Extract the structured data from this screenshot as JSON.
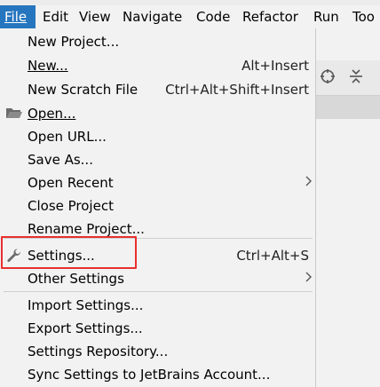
{
  "menubar": {
    "items": [
      {
        "label": "File",
        "mnemonic_index": 0
      },
      {
        "label": "Edit",
        "mnemonic_index": 0
      },
      {
        "label": "View",
        "mnemonic_index": 0
      },
      {
        "label": "Navigate",
        "mnemonic_index": 0
      },
      {
        "label": "Code",
        "mnemonic_index": 0
      },
      {
        "label": "Refactor",
        "mnemonic_index": 0
      },
      {
        "label": "Run",
        "mnemonic_index": 1
      },
      {
        "label": "Too",
        "mnemonic_index": 2
      }
    ]
  },
  "menu": {
    "items": [
      {
        "label": "New Project...",
        "shortcut": ""
      },
      {
        "label": "New...",
        "shortcut": "Alt+Insert"
      },
      {
        "label": "New Scratch File",
        "shortcut": "Ctrl+Alt+Shift+Insert"
      },
      {
        "label": "Open...",
        "shortcut": "",
        "icon": "folder-icon"
      },
      {
        "label": "Open URL...",
        "shortcut": ""
      },
      {
        "label": "Save As...",
        "shortcut": ""
      },
      {
        "label": "Open Recent",
        "shortcut": "",
        "submenu": true
      },
      {
        "label": "Close Project",
        "shortcut": ""
      },
      {
        "label": "Rename Project...",
        "shortcut": ""
      },
      {
        "label": "Settings...",
        "shortcut": "Ctrl+Alt+S",
        "icon": "wrench-icon"
      },
      {
        "label": "Other Settings",
        "shortcut": "",
        "submenu": true
      },
      {
        "label": "Import Settings...",
        "shortcut": ""
      },
      {
        "label": "Export Settings...",
        "shortcut": ""
      },
      {
        "label": "Settings Repository...",
        "shortcut": ""
      },
      {
        "label": "Sync Settings to JetBrains Account...",
        "shortcut": ""
      }
    ]
  },
  "colors": {
    "menubar_active": "#2675bf",
    "highlight_border": "#e8302f",
    "menu_background": "#f2f2f2"
  }
}
